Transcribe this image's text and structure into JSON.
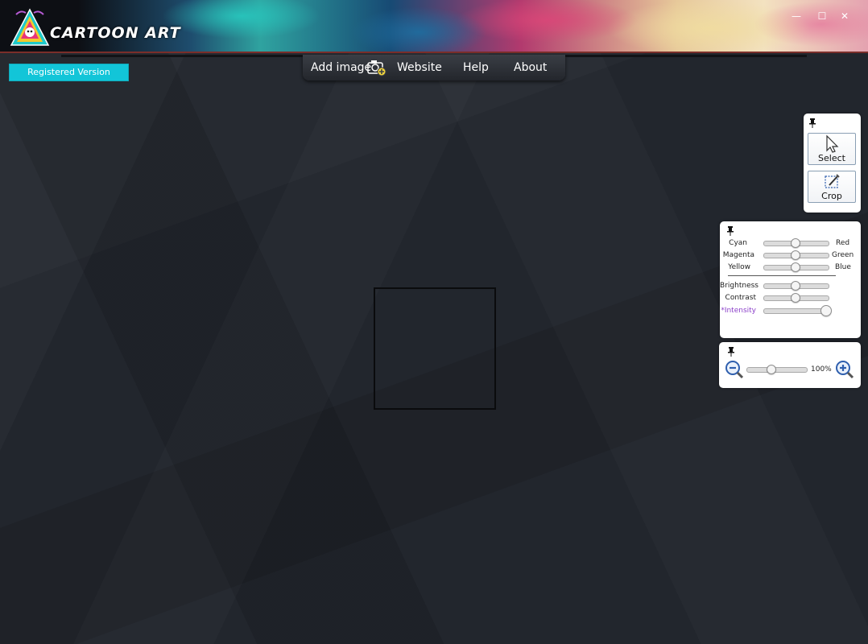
{
  "app": {
    "logo_text": "CARTOON ART",
    "window_controls": {
      "minimize": "—",
      "maximize": "☐",
      "close": "✕"
    }
  },
  "nav": {
    "add_image": "Add image",
    "website": "Website",
    "help": "Help",
    "about": "About"
  },
  "registered_label": "Registered Version",
  "tools": {
    "select_label": "Select",
    "crop_label": "Crop"
  },
  "adjust": {
    "color_sliders": [
      {
        "left": "Cyan",
        "right": "Red",
        "value": 0.5
      },
      {
        "left": "Magenta",
        "right": "Green",
        "value": 0.5
      },
      {
        "left": "Yellow",
        "right": "Blue",
        "value": 0.5
      }
    ],
    "brightness": {
      "label": "Brightness",
      "value": 0.5
    },
    "contrast": {
      "label": "Contrast",
      "value": 0.5
    },
    "intensity": {
      "label": "*Intensity",
      "value": 0.97
    }
  },
  "zoom": {
    "level_text": "100%",
    "value": 0.42
  },
  "colors": {
    "accent": "#12c5d8",
    "intensity_label": "#8b3fc9",
    "zoom_icon_blue": "#2f5fae"
  }
}
